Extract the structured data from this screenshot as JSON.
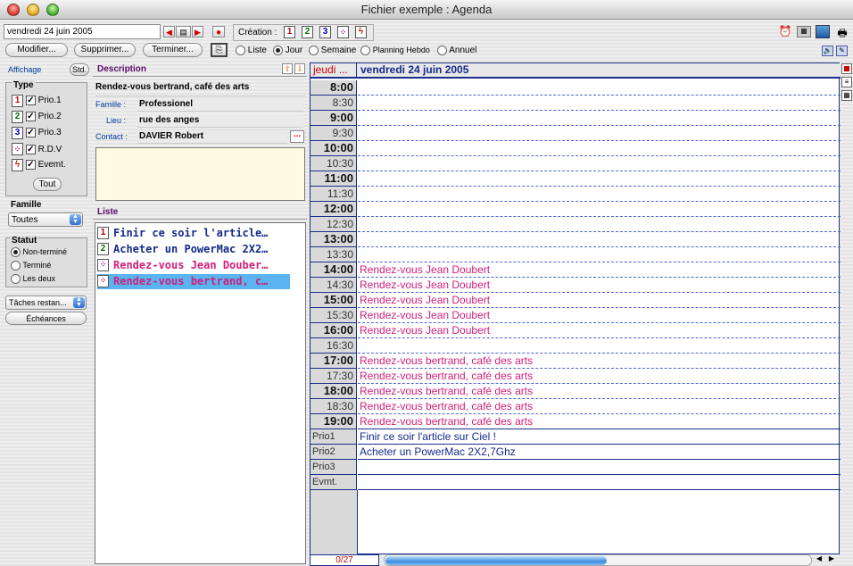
{
  "window": {
    "title": "Fichier exemple : Agenda"
  },
  "toolbar": {
    "date_field": "vendredi 24 juin 2005",
    "creation_label": "Création :",
    "creation_buttons": [
      "1",
      "2",
      "3"
    ],
    "modifier": "Modifier...",
    "supprimer": "Supprimer...",
    "terminer": "Terminer...",
    "views": [
      "Liste",
      "Jour",
      "Semaine",
      "Planning Hebdo",
      "Annuel"
    ],
    "selected_view": "Jour"
  },
  "sidebar": {
    "affichage": "Affichage",
    "std": "Std.",
    "type_label": "Type",
    "types": [
      {
        "box": "1",
        "label": "Prio.1",
        "checked": true
      },
      {
        "box": "2",
        "label": "Prio.2",
        "checked": true
      },
      {
        "box": "3",
        "label": "Prio.3",
        "checked": true
      },
      {
        "box": "",
        "label": "R.D.V",
        "checked": true
      },
      {
        "box": "",
        "label": "Evemt.",
        "checked": true
      }
    ],
    "tout": "Tout",
    "famille_label": "Famille",
    "famille_value": "Toutes",
    "statut_label": "Statut",
    "statut_options": [
      "Non-terminé",
      "Terminé",
      "Les deux"
    ],
    "statut_selected": "Non-terminé",
    "taches": "Tâches restan...",
    "echeances": "Échéances"
  },
  "description": {
    "header": "Description",
    "title": "Rendez-vous bertrand, café des arts",
    "famille_label": "Famille :",
    "famille_value": "Professionel",
    "lieu_label": "Lieu :",
    "lieu_value": "rue des anges",
    "contact_label": "Contact :",
    "contact_value": "DAVIER Robert",
    "more": "..."
  },
  "liste": {
    "header": "Liste",
    "items": [
      {
        "box": "1",
        "text": "Finir ce soir l'article…"
      },
      {
        "box": "2",
        "text": "Acheter un PowerMac 2X2…"
      },
      {
        "box": "",
        "text": "Rendez-vous Jean Douber…"
      },
      {
        "box": "",
        "text": "Rendez-vous bertrand, c…"
      }
    ]
  },
  "agenda": {
    "prev_day": "jeudi ...",
    "current_day": "vendredi 24 juin 2005",
    "slots": [
      {
        "time": "8:00",
        "text": ""
      },
      {
        "time": "8:30",
        "text": ""
      },
      {
        "time": "9:00",
        "text": ""
      },
      {
        "time": "9:30",
        "text": ""
      },
      {
        "time": "10:00",
        "text": ""
      },
      {
        "time": "10:30",
        "text": ""
      },
      {
        "time": "11:00",
        "text": ""
      },
      {
        "time": "11:30",
        "text": ""
      },
      {
        "time": "12:00",
        "text": ""
      },
      {
        "time": "12:30",
        "text": ""
      },
      {
        "time": "13:00",
        "text": ""
      },
      {
        "time": "13:30",
        "text": ""
      },
      {
        "time": "14:00",
        "text": "Rendez-vous Jean Doubert"
      },
      {
        "time": "14:30",
        "text": "Rendez-vous Jean Doubert"
      },
      {
        "time": "15:00",
        "text": "Rendez-vous Jean Doubert"
      },
      {
        "time": "15:30",
        "text": "Rendez-vous Jean Doubert"
      },
      {
        "time": "16:00",
        "text": "Rendez-vous Jean Doubert"
      },
      {
        "time": "16:30",
        "text": ""
      },
      {
        "time": "17:00",
        "text": "Rendez-vous bertrand, café des arts"
      },
      {
        "time": "17:30",
        "text": "Rendez-vous bertrand, café des arts"
      },
      {
        "time": "18:00",
        "text": "Rendez-vous bertrand, café des arts"
      },
      {
        "time": "18:30",
        "text": "Rendez-vous bertrand, café des arts"
      },
      {
        "time": "19:00",
        "text": "Rendez-vous bertrand, café des arts"
      }
    ],
    "tasks": [
      {
        "label": "Prio1",
        "text": "Finir ce soir l'article sur Ciel !"
      },
      {
        "label": "Prio2",
        "text": "Acheter un PowerMac 2X2,7Ghz"
      },
      {
        "label": "Prio3",
        "text": ""
      },
      {
        "label": "Evmt.",
        "text": ""
      }
    ],
    "counter": "0/27"
  },
  "colors": {
    "event_pink": "#d0207a",
    "task_blue": "#142a8c",
    "grid_blue": "#1a2f8a",
    "selection": "#5ab4f0"
  }
}
